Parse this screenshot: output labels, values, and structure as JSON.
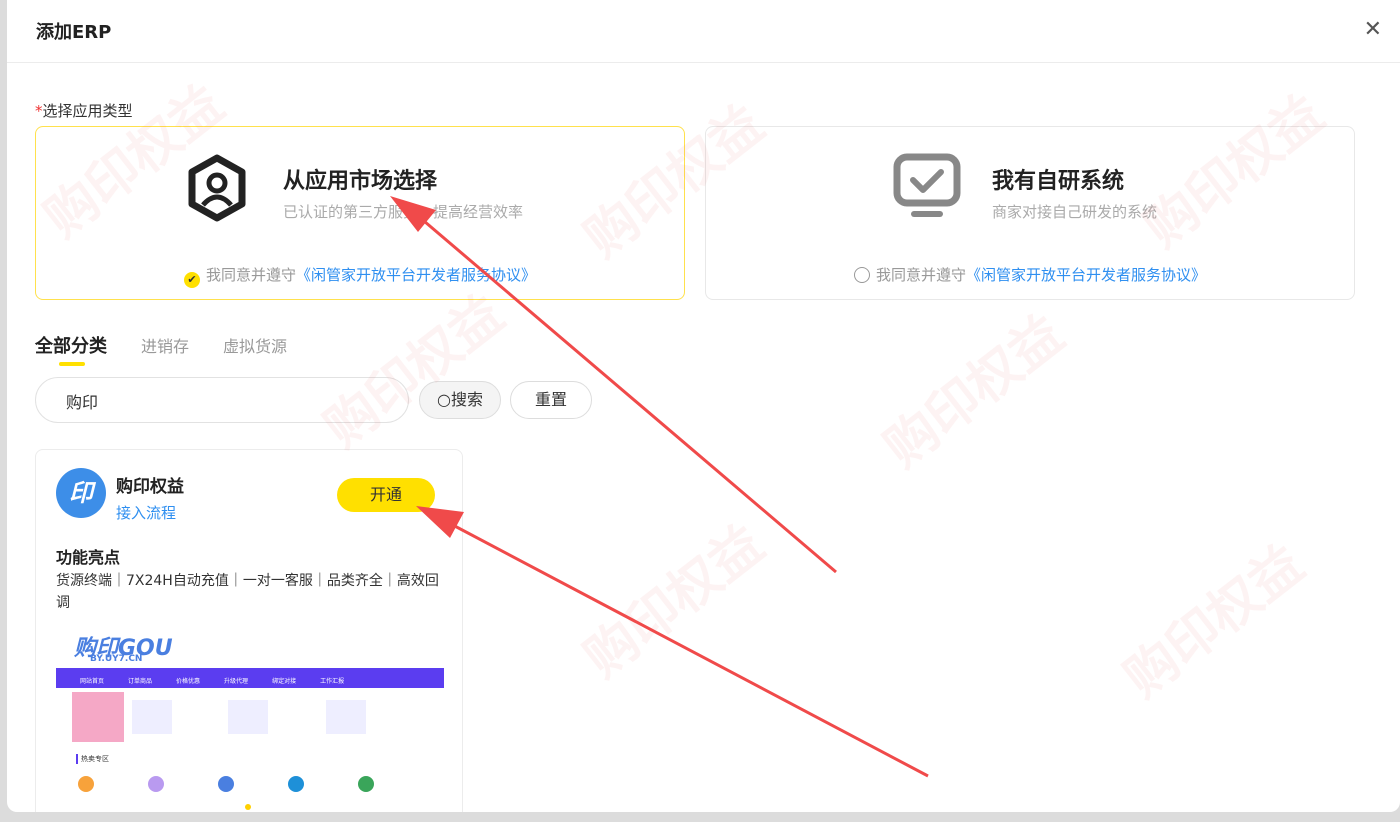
{
  "modal": {
    "title": "添加ERP",
    "close_icon": "close-icon"
  },
  "form": {
    "required_mark": "*",
    "label": "选择应用类型"
  },
  "cards": [
    {
      "title": "从应用市场选择",
      "subtitle": "已认证的第三方服务，提高经营效率",
      "agree_text": "我同意并遵守",
      "agree_link": "《闲管家开放平台开发者服务协议》",
      "checked": true
    },
    {
      "title": "我有自研系统",
      "subtitle": "商家对接自己研发的系统",
      "agree_text": "我同意并遵守",
      "agree_link": "《闲管家开放平台开发者服务协议》",
      "checked": false
    }
  ],
  "tabs": [
    {
      "label": "全部分类"
    },
    {
      "label": "进销存"
    },
    {
      "label": "虚拟货源"
    }
  ],
  "search": {
    "value": "购印",
    "search_button": "搜索",
    "reset_button": "重置"
  },
  "app": {
    "logo_text": "印",
    "name": "购印权益",
    "link": "接入流程",
    "open_button": "开通",
    "features_title": "功能亮点",
    "features": "货源终端｜7X24H自动充值｜一对一客服｜品类齐全｜高效回调",
    "screenshot": {
      "logo": "购印GOU",
      "domain": "BY.UY7.CN",
      "nav": [
        "网站首页",
        "订单商品",
        "价格优惠",
        "升级代理",
        "绑定对接",
        "工作汇报"
      ],
      "hot_label": "热卖专区"
    }
  },
  "watermark": "购印权益",
  "colors": {
    "accent": "#ffe000",
    "link": "#2f8ff0",
    "arrow": "#f04a4a"
  }
}
